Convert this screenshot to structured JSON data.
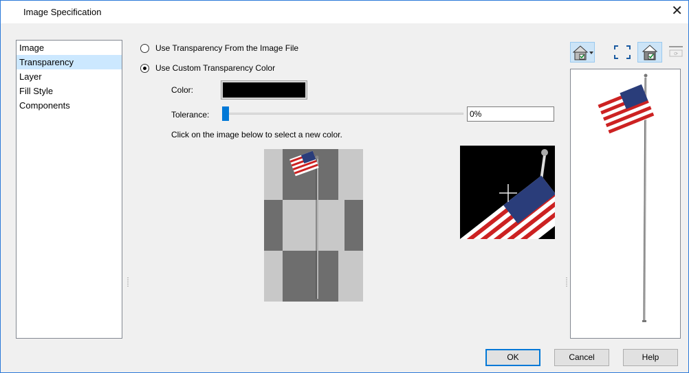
{
  "window": {
    "title": "Image Specification"
  },
  "sidebar": {
    "items": [
      {
        "label": "Image"
      },
      {
        "label": "Transparency"
      },
      {
        "label": "Layer"
      },
      {
        "label": "Fill Style"
      },
      {
        "label": "Components"
      }
    ],
    "selected": "Transparency"
  },
  "transparency": {
    "option_file": "Use Transparency From the Image File",
    "option_custom": "Use Custom Transparency Color",
    "selected": "custom",
    "color_label": "Color:",
    "color_value": "#000000",
    "tolerance_label": "Tolerance:",
    "tolerance_value": "0%",
    "tolerance_level": 0,
    "instruction": "Click on the image below to select a new color."
  },
  "toolbar": {
    "icons": [
      "camera-view-options-icon",
      "dropdown-arrow-icon",
      "fill-window-icon",
      "render-preview-icon",
      "refresh-icon"
    ]
  },
  "buttons": {
    "ok": "OK",
    "cancel": "Cancel",
    "help": "Help"
  },
  "colors": {
    "accent": "#0078d7",
    "selection": "#cce8ff",
    "checker_light": "#c8c8c8",
    "checker_dark": "#6e6e6e"
  }
}
